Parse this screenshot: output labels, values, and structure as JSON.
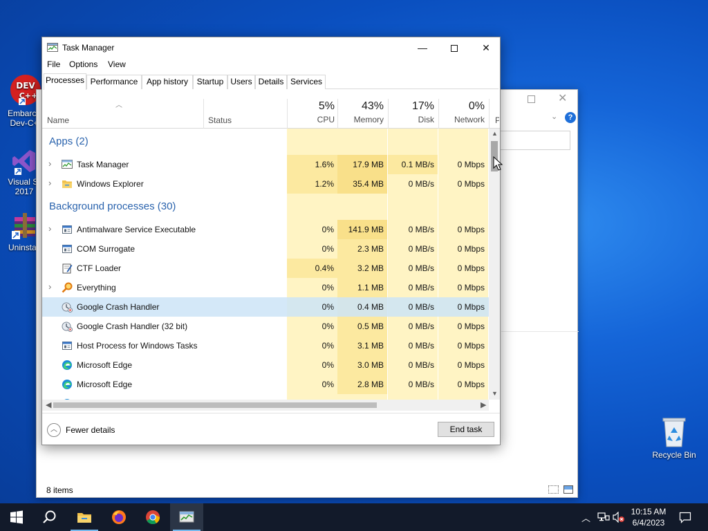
{
  "desktop": {
    "icons": [
      {
        "label_line1": "Embarca",
        "label_line2": "Dev-C+"
      },
      {
        "label_line1": "Visual St",
        "label_line2": "2017"
      },
      {
        "label_line1": "Uninstall",
        "label_line2": ""
      },
      {
        "label_line1": "Recycle Bin",
        "label_line2": ""
      }
    ],
    "dev_icon_text": "DEV"
  },
  "bg_window": {
    "status": "8 items"
  },
  "task_manager": {
    "title": "Task Manager",
    "menu": [
      "File",
      "Options",
      "View"
    ],
    "tabs": [
      "Processes",
      "Performance",
      "App history",
      "Startup",
      "Users",
      "Details",
      "Services"
    ],
    "active_tab": "Processes",
    "columns": {
      "name": "Name",
      "status": "Status",
      "cpu": {
        "pct": "5%",
        "label": "CPU"
      },
      "memory": {
        "pct": "43%",
        "label": "Memory"
      },
      "disk": {
        "pct": "17%",
        "label": "Disk"
      },
      "network": {
        "pct": "0%",
        "label": "Network"
      },
      "cut_col": "P"
    },
    "groups": {
      "apps": "Apps (2)",
      "background": "Background processes (30)"
    },
    "apps": [
      {
        "name": "Task Manager",
        "cpu": "1.6%",
        "memory": "17.9 MB",
        "disk": "0.1 MB/s",
        "network": "0 Mbps",
        "icon": "task-manager-icon"
      },
      {
        "name": "Windows Explorer",
        "cpu": "1.2%",
        "memory": "35.4 MB",
        "disk": "0 MB/s",
        "network": "0 Mbps",
        "icon": "folder-icon"
      }
    ],
    "background": [
      {
        "name": "Antimalware Service Executable",
        "cpu": "0%",
        "memory": "141.9 MB",
        "disk": "0 MB/s",
        "network": "0 Mbps",
        "icon": "service-window-icon",
        "expandable": true
      },
      {
        "name": "COM Surrogate",
        "cpu": "0%",
        "memory": "2.3 MB",
        "disk": "0 MB/s",
        "network": "0 Mbps",
        "icon": "service-window-icon",
        "expandable": false
      },
      {
        "name": "CTF Loader",
        "cpu": "0.4%",
        "memory": "3.2 MB",
        "disk": "0 MB/s",
        "network": "0 Mbps",
        "icon": "notepad-pen-icon",
        "expandable": false
      },
      {
        "name": "Everything",
        "cpu": "0%",
        "memory": "1.1 MB",
        "disk": "0 MB/s",
        "network": "0 Mbps",
        "icon": "magnifier-icon",
        "expandable": true
      },
      {
        "name": "Google Crash Handler",
        "cpu": "0%",
        "memory": "0.4 MB",
        "disk": "0 MB/s",
        "network": "0 Mbps",
        "icon": "crash-handler-icon",
        "expandable": false,
        "selected": true
      },
      {
        "name": "Google Crash Handler (32 bit)",
        "cpu": "0%",
        "memory": "0.5 MB",
        "disk": "0 MB/s",
        "network": "0 Mbps",
        "icon": "crash-handler-icon",
        "expandable": false
      },
      {
        "name": "Host Process for Windows Tasks",
        "cpu": "0%",
        "memory": "3.1 MB",
        "disk": "0 MB/s",
        "network": "0 Mbps",
        "icon": "service-window-icon",
        "expandable": false
      },
      {
        "name": "Microsoft Edge",
        "cpu": "0%",
        "memory": "3.0 MB",
        "disk": "0 MB/s",
        "network": "0 Mbps",
        "icon": "edge-icon",
        "expandable": false
      },
      {
        "name": "Microsoft Edge",
        "cpu": "0%",
        "memory": "2.8 MB",
        "disk": "0 MB/s",
        "network": "0 Mbps",
        "icon": "edge-icon",
        "expandable": false
      }
    ],
    "footer": {
      "fewer_details": "Fewer details",
      "end_task": "End task"
    }
  },
  "taskbar": {
    "apps": [
      "start-icon",
      "search-icon",
      "file-explorer-icon",
      "firefox-icon",
      "chrome-icon",
      "task-manager-icon"
    ],
    "clock_time": "10:15 AM",
    "clock_date": "6/4/2023"
  },
  "colors": {
    "heat_light": "#fff4c4",
    "heat_mid": "#fce9a0",
    "heat_strong": "#f9e08a",
    "selected_row": "#cce4f7",
    "group_title": "#2a63ad"
  }
}
